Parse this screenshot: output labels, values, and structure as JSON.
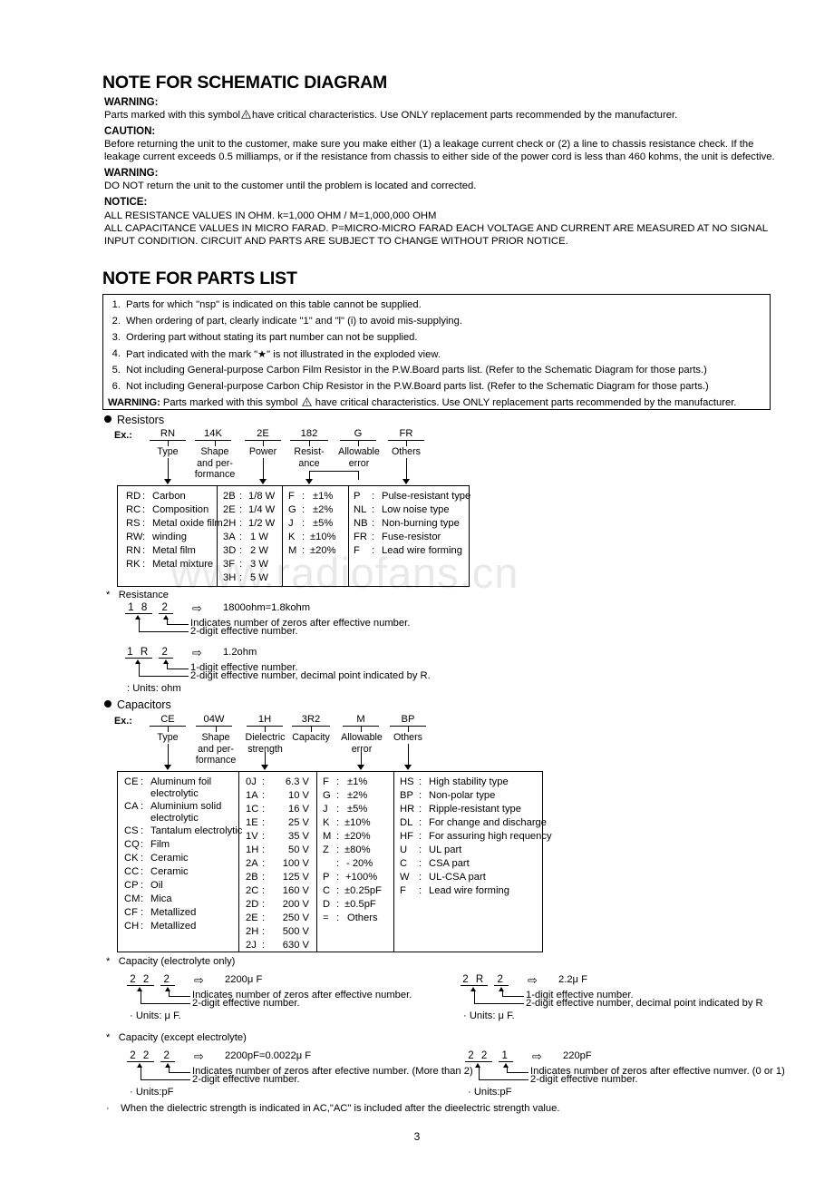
{
  "document": {
    "page_number": "3",
    "watermark": "www.radiofans.cn"
  },
  "schematic_note": {
    "title": "NOTE FOR SCHEMATIC DIAGRAM",
    "blocks": [
      {
        "label": "WARNING:",
        "lines": [
          "Parts marked with this symbol ⚠ have critical characteristics. Use ONLY replacement parts recommended by the manufacturer."
        ]
      },
      {
        "label": "CAUTION:",
        "lines": [
          "Before returning the unit to the customer, make sure you make either (1) a leakage current check or (2) a line to chassis resistance check. If the",
          "leakage current exceeds 0.5 milliamps, or if the resistance from chassis to either side of the power cord is less than 460 kohms, the unit is defective."
        ]
      },
      {
        "label": "WARNING:",
        "lines": [
          "DO NOT return the unit to the customer until the problem is located and corrected."
        ]
      },
      {
        "label": "NOTICE:",
        "lines": [
          "ALL RESISTANCE VALUES IN OHM. k=1,000 OHM / M=1,000,000 OHM",
          "ALL CAPACITANCE VALUES IN MICRO FARAD. P=MICRO-MICRO FARAD EACH VOLTAGE AND CURRENT ARE MEASURED AT NO SIGNAL",
          "INPUT CONDITION. CIRCUIT AND PARTS ARE SUBJECT TO CHANGE WITHOUT PRIOR NOTICE."
        ]
      }
    ],
    "warning_symbol_prefix": "Parts marked with this symbol",
    "warning_symbol_suffix": "have critical characteristics. Use ONLY replacement parts recommended by the manufacturer."
  },
  "parts_list_note": {
    "title": "NOTE FOR PARTS LIST",
    "items": [
      {
        "num": "1.",
        "text": "Parts for which \"nsp\" is indicated on this table cannot be supplied."
      },
      {
        "num": "2.",
        "text": "When ordering of part, clearly indicate \"1\" and \"l\" (i) to avoid mis-supplying."
      },
      {
        "num": "3.",
        "text": "Ordering part without stating its part number can not be supplied."
      },
      {
        "num": "4.",
        "text": "Part indicated with the mark \"★\" is not illustrated in the exploded view."
      },
      {
        "num": "5.",
        "text": "Not including General-purpose Carbon Film Resistor in the P.W.Board parts list. (Refer to the Schematic Diagram for those parts.)"
      },
      {
        "num": "6.",
        "text": "Not including General-purpose Carbon Chip Resistor in the P.W.Board parts list. (Refer to the Schematic Diagram for those parts.)"
      }
    ],
    "warning_label": "WARNING:",
    "warning_prefix": "Parts marked with this symbol",
    "warning_suffix": "have critical characteristics. Use ONLY replacement parts recommended by the manufacturer."
  },
  "resistors": {
    "section_title": "Resistors",
    "example_label": "Ex.:",
    "code_fields": [
      {
        "code": "RN",
        "label": "Type"
      },
      {
        "code": "14K",
        "label": "Shape\nand per-\nformance"
      },
      {
        "code": "2E",
        "label": "Power"
      },
      {
        "code": "182",
        "label": "Resist-\nance"
      },
      {
        "code": "G",
        "label": "Allowable\nerror"
      },
      {
        "code": "FR",
        "label": "Others"
      }
    ],
    "col_type": [
      {
        "code": "RD",
        "value": "Carbon"
      },
      {
        "code": "RC",
        "value": "Composition"
      },
      {
        "code": "RS",
        "value": "Metal oxide film"
      },
      {
        "code": "RW",
        "value": "winding"
      },
      {
        "code": "RN",
        "value": "Metal film"
      },
      {
        "code": "RK",
        "value": "Metal mixture"
      }
    ],
    "col_power": [
      {
        "code": "2B",
        "value": "1/8 W"
      },
      {
        "code": "2E",
        "value": "1/4 W"
      },
      {
        "code": "2H",
        "value": "1/2 W"
      },
      {
        "code": "3A",
        "value": "1  W"
      },
      {
        "code": "3D",
        "value": "2  W"
      },
      {
        "code": "3F",
        "value": "3  W"
      },
      {
        "code": "3H",
        "value": "5  W"
      }
    ],
    "col_error": [
      {
        "code": "F",
        "value": "±1%"
      },
      {
        "code": "G",
        "value": "±2%"
      },
      {
        "code": "J",
        "value": "±5%"
      },
      {
        "code": "K",
        "value": "±10%"
      },
      {
        "code": "M",
        "value": "±20%"
      }
    ],
    "col_others": [
      {
        "code": "P",
        "value": "Pulse-resistant type"
      },
      {
        "code": "NL",
        "value": "Low noise type"
      },
      {
        "code": "NB",
        "value": "Non-burning type"
      },
      {
        "code": "FR",
        "value": "Fuse-resistor"
      },
      {
        "code": "F",
        "value": "Lead wire forming"
      }
    ],
    "notation": {
      "title": "Resistance",
      "examples": [
        {
          "digits_left": "1 8",
          "digits_right": "2",
          "result": "1800ohm=1.8kohm",
          "note_top": "Indicates number of zeros after effective number.",
          "note_bottom": "2-digit effective number.",
          "units": ""
        },
        {
          "digits_left": "1 R",
          "digits_right": "2",
          "result": "1.2ohm",
          "note_top": "1-digit effective number.",
          "note_bottom": "2-digit effective number, decimal point indicated by R.",
          "units": ": Units: ohm"
        }
      ]
    }
  },
  "capacitors": {
    "section_title": "Capacitors",
    "example_label": "Ex.:",
    "code_fields": [
      {
        "code": "CE",
        "label": "Type"
      },
      {
        "code": "04W",
        "label": "Shape\nand per-\nformance"
      },
      {
        "code": "1H",
        "label": "Dielectric\nstrength"
      },
      {
        "code": "3R2",
        "label": "Capacity"
      },
      {
        "code": "M",
        "label": "Allowable\nerror"
      },
      {
        "code": "BP",
        "label": "Others"
      }
    ],
    "col_type": [
      {
        "code": "CE",
        "value": "Aluminum foil",
        "value2": "electrolytic"
      },
      {
        "code": "CA",
        "value": "Aluminium solid",
        "value2": "electrolytic"
      },
      {
        "code": "CS",
        "value": "Tantalum electrolytic",
        "value2": ""
      },
      {
        "code": "CQ",
        "value": "Film",
        "value2": ""
      },
      {
        "code": "CK",
        "value": "Ceramic",
        "value2": ""
      },
      {
        "code": "CC",
        "value": "Ceramic",
        "value2": ""
      },
      {
        "code": "CP",
        "value": "Oil",
        "value2": ""
      },
      {
        "code": "CM",
        "value": "Mica",
        "value2": ""
      },
      {
        "code": "CF",
        "value": "Metallized",
        "value2": ""
      },
      {
        "code": "CH",
        "value": "Metallized",
        "value2": ""
      }
    ],
    "col_voltage": [
      {
        "code": "0J",
        "value": "6.3 V"
      },
      {
        "code": "1A",
        "value": "10  V"
      },
      {
        "code": "1C",
        "value": "16  V"
      },
      {
        "code": "1E",
        "value": "25  V"
      },
      {
        "code": "1V",
        "value": "35  V"
      },
      {
        "code": "1H",
        "value": "50  V"
      },
      {
        "code": "2A",
        "value": "100 V"
      },
      {
        "code": "2B",
        "value": "125 V"
      },
      {
        "code": "2C",
        "value": "160 V"
      },
      {
        "code": "2D",
        "value": "200 V"
      },
      {
        "code": "2E",
        "value": "250 V"
      },
      {
        "code": "2H",
        "value": "500 V"
      },
      {
        "code": "2J",
        "value": "630 V"
      }
    ],
    "col_error": [
      {
        "code": "F",
        "value": "±1%"
      },
      {
        "code": "G",
        "value": "±2%"
      },
      {
        "code": "J",
        "value": "±5%"
      },
      {
        "code": "K",
        "value": "±10%"
      },
      {
        "code": "M",
        "value": "±20%"
      },
      {
        "code": "Z",
        "value": "±80%"
      },
      {
        "code": "",
        "value": "- 20%"
      },
      {
        "code": "P",
        "value": "+100%"
      },
      {
        "code": "C",
        "value": "±0.25pF"
      },
      {
        "code": "D",
        "value": "±0.5pF"
      },
      {
        "code": "=",
        "value": "Others"
      }
    ],
    "col_others": [
      {
        "code": "HS",
        "value": "High stability type"
      },
      {
        "code": "BP",
        "value": "Non-polar type"
      },
      {
        "code": "HR",
        "value": "Ripple-resistant type"
      },
      {
        "code": "DL",
        "value": "For change and discharge"
      },
      {
        "code": "HF",
        "value": "For assuring high requency"
      },
      {
        "code": "U",
        "value": "UL part"
      },
      {
        "code": "C",
        "value": "CSA part"
      },
      {
        "code": "W",
        "value": "UL-CSA part"
      },
      {
        "code": "F",
        "value": "Lead wire forming"
      }
    ],
    "notation_electrolyte": {
      "title": "Capacity (electrolyte only)",
      "examples": [
        {
          "digits_left": "2 2",
          "digits_right": "2",
          "result": "2200μ F",
          "note_top": "Indicates number of zeros after effective number.",
          "note_bottom": "2-digit effective number.",
          "units": "· Units: μ F."
        },
        {
          "digits_left": "2 R",
          "digits_right": "2",
          "result": "2.2μ F",
          "note_top": "1-digit effective number.",
          "note_bottom": "2-digit effective number, decimal point indicated by R",
          "units": "· Units: μ F."
        }
      ]
    },
    "notation_except": {
      "title": "Capacity (except electrolyte)",
      "examples": [
        {
          "digits_left": "2 2",
          "digits_right": "2",
          "result": "2200pF=0.0022μ F",
          "note_top": "Indicates number of zeros after efective number. (More than 2)",
          "note_bottom": "2-digit effective number.",
          "units": "· Units:pF"
        },
        {
          "digits_left": "2 2",
          "digits_right": "1",
          "result": "220pF",
          "note_top": "Indicates number of zeros after effective numver. (0 or 1)",
          "note_bottom": "2-digit effective number.",
          "units": "· Units:pF"
        }
      ]
    },
    "footnote": "When the dielectric strength is indicated in AC,\"AC\" is included after the dieelectric strength value."
  }
}
